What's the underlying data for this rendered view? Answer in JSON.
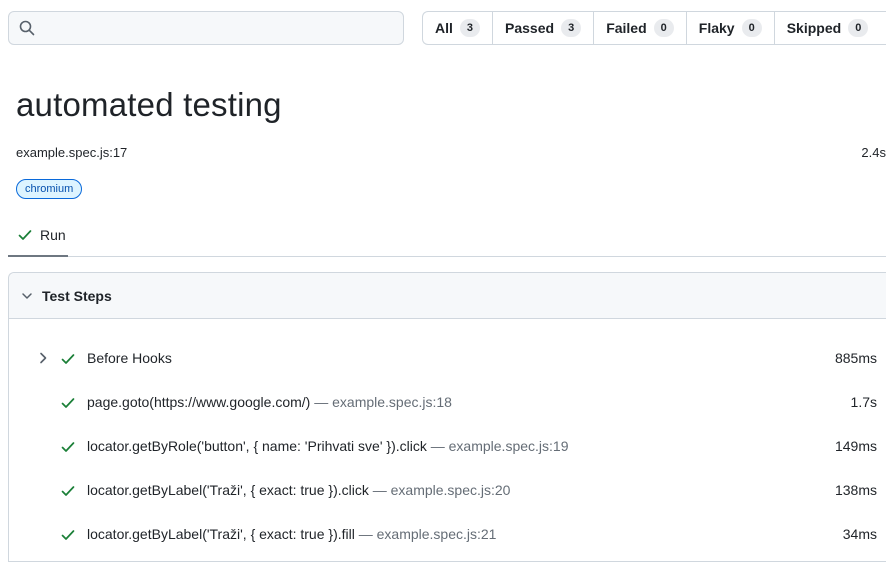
{
  "search": {
    "value": "",
    "placeholder": ""
  },
  "filters": [
    {
      "label": "All",
      "count": "3"
    },
    {
      "label": "Passed",
      "count": "3"
    },
    {
      "label": "Failed",
      "count": "0"
    },
    {
      "label": "Flaky",
      "count": "0"
    },
    {
      "label": "Skipped",
      "count": "0"
    }
  ],
  "test": {
    "title": "automated testing",
    "location": "example.spec.js:17",
    "duration": "2.4s",
    "tag": "chromium"
  },
  "tabs": {
    "run_label": "Run"
  },
  "steps_panel": {
    "header": "Test Steps",
    "steps": [
      {
        "title": "Before Hooks",
        "location": "",
        "duration": "885ms",
        "expandable": true
      },
      {
        "title": "page.goto(https://www.google.com/)",
        "location": " — example.spec.js:18",
        "duration": "1.7s",
        "expandable": false
      },
      {
        "title": "locator.getByRole('button', { name: 'Prihvati sve' }).click",
        "location": " — example.spec.js:19",
        "duration": "149ms",
        "expandable": false
      },
      {
        "title": "locator.getByLabel('Traži', { exact: true }).click",
        "location": " — example.spec.js:20",
        "duration": "138ms",
        "expandable": false
      },
      {
        "title": "locator.getByLabel('Traži', { exact: true }).fill",
        "location": " — example.spec.js:21",
        "duration": "34ms",
        "expandable": false
      }
    ]
  },
  "colors": {
    "success": "#1a7f37",
    "accent": "#0969da",
    "border": "#d0d7de"
  },
  "icons": {
    "search": "search-icon",
    "check": "check-icon",
    "chevron_right": "chevron-right-icon",
    "chevron_down": "chevron-down-icon"
  }
}
